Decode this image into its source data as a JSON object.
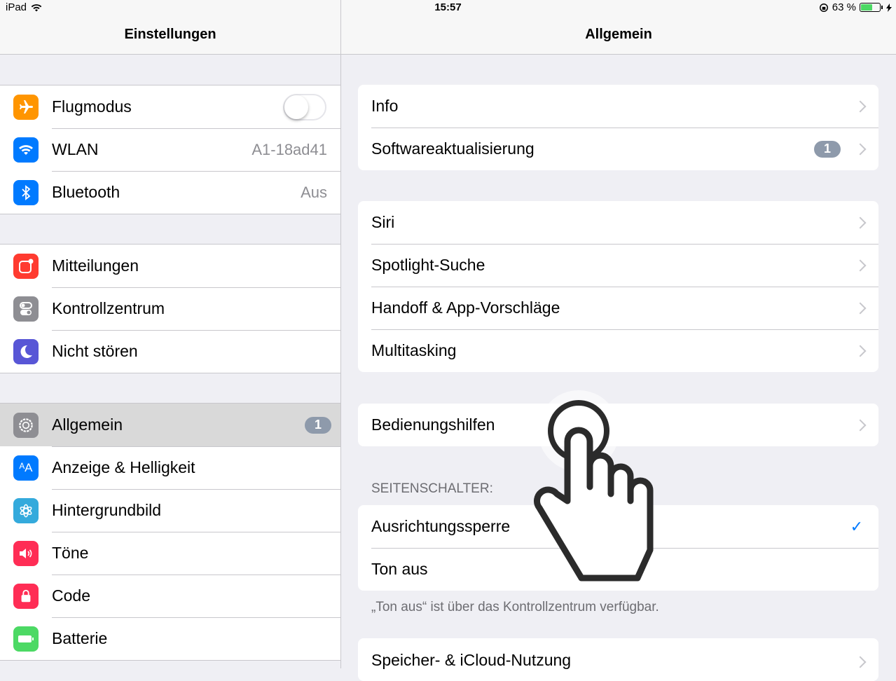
{
  "status": {
    "device": "iPad",
    "time": "15:57",
    "battery_percent": "63 %",
    "battery_level": 0.63
  },
  "left": {
    "title": "Einstellungen",
    "groups": [
      [
        {
          "label": "Flugmodus",
          "icon": "airplane-icon",
          "icon_color": "#ff9500",
          "toggle": false
        },
        {
          "label": "WLAN",
          "icon": "wifi-icon",
          "icon_color": "#007aff",
          "value": "A1-18ad41"
        },
        {
          "label": "Bluetooth",
          "icon": "bluetooth-icon",
          "icon_color": "#007aff",
          "value": "Aus"
        }
      ],
      [
        {
          "label": "Mitteilungen",
          "icon": "notifications-icon",
          "icon_color": "#ff3b30"
        },
        {
          "label": "Kontrollzentrum",
          "icon": "control-center-icon",
          "icon_color": "#8e8e93"
        },
        {
          "label": "Nicht stören",
          "icon": "moon-icon",
          "icon_color": "#5856d6"
        }
      ],
      [
        {
          "label": "Allgemein",
          "icon": "gear-icon",
          "icon_color": "#8e8e93",
          "badge": "1"
        },
        {
          "label": "Anzeige & Helligkeit",
          "icon": "display-icon",
          "icon_color": "#007aff"
        },
        {
          "label": "Hintergrundbild",
          "icon": "wallpaper-icon",
          "icon_color": "#34aadc"
        },
        {
          "label": "Töne",
          "icon": "speaker-icon",
          "icon_color": "#ff2d55"
        },
        {
          "label": "Code",
          "icon": "lock-icon",
          "icon_color": "#ff2d55"
        },
        {
          "label": "Batterie",
          "icon": "battery-icon",
          "icon_color": "#4cd964"
        }
      ]
    ]
  },
  "right": {
    "title": "Allgemein",
    "group1": [
      {
        "label": "Info"
      },
      {
        "label": "Softwareaktualisierung",
        "badge": "1"
      }
    ],
    "group2": [
      {
        "label": "Siri"
      },
      {
        "label": "Spotlight-Suche"
      },
      {
        "label": "Handoff & App-Vorschläge"
      },
      {
        "label": "Multitasking"
      }
    ],
    "group3": [
      {
        "label": "Bedienungshilfen"
      }
    ],
    "side_switch_header": "SEITENSCHALTER:",
    "group4": [
      {
        "label": "Ausrichtungssperre",
        "checked": true
      },
      {
        "label": "Ton aus",
        "checked": false
      }
    ],
    "side_switch_footer": "„Ton aus“ ist über das Kontrollzentrum verfügbar.",
    "group5": [
      {
        "label": "Speicher- & iCloud-Nutzung"
      }
    ]
  }
}
